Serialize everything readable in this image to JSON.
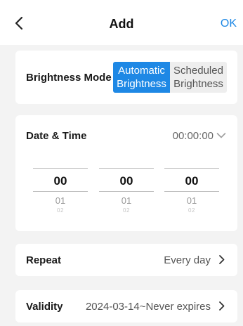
{
  "header": {
    "title": "Add",
    "ok_label": "OK"
  },
  "brightness_mode": {
    "label": "Brightness Mode",
    "options": [
      {
        "line1": "Automatic",
        "line2": "Brightness",
        "selected": true
      },
      {
        "line1": "Scheduled",
        "line2": "Brightness",
        "selected": false
      }
    ]
  },
  "date_time": {
    "label": "Date & Time",
    "value": "00:00:00",
    "wheels": [
      {
        "selected": "00",
        "next": "01",
        "next2": "02"
      },
      {
        "selected": "00",
        "next": "01",
        "next2": "02"
      },
      {
        "selected": "00",
        "next": "01",
        "next2": "02"
      }
    ]
  },
  "repeat": {
    "label": "Repeat",
    "value": "Every day"
  },
  "validity": {
    "label": "Validity",
    "value": "2024-03-14~Never expires"
  },
  "colors": {
    "accent": "#1e88e5",
    "background": "#f3f3f3",
    "card": "#ffffff"
  },
  "icons": {
    "back": "chevron-left-icon",
    "dropdown": "chevron-down-icon",
    "row_arrow": "chevron-right-icon"
  }
}
